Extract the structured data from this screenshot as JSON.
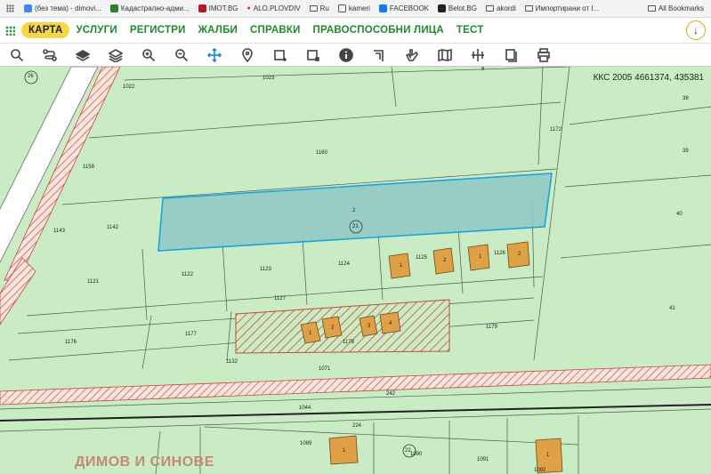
{
  "bookmarks": {
    "items": [
      {
        "label": "(без тема) - dimovi...",
        "icon": "google-icon"
      },
      {
        "label": "Кадастрално-адми...",
        "icon": "cadastre-icon"
      },
      {
        "label": "IMOT.BG",
        "icon": "imot-icon"
      },
      {
        "label": "ALO.PLOVDIV",
        "icon": "alo-icon"
      },
      {
        "label": "Ru",
        "icon": "folder-icon"
      },
      {
        "label": "kameri",
        "icon": "camera-icon"
      },
      {
        "label": "FACEBOOK",
        "icon": "facebook-icon"
      },
      {
        "label": "Belot.BG",
        "icon": "belot-icon"
      },
      {
        "label": "akordi",
        "icon": "folder-icon"
      },
      {
        "label": "Импортирани от I...",
        "icon": "folder-icon"
      }
    ],
    "all_label": "All Bookmarks"
  },
  "menu": {
    "items": [
      "КАРТА",
      "УСЛУГИ",
      "РЕГИСТРИ",
      "ЖАЛБИ",
      "СПРАВКИ",
      "ПРАВОСПОСОБНИ ЛИЦА",
      "ТЕСТ"
    ],
    "active": "КАРТА"
  },
  "toolbar": {
    "tools": [
      "search",
      "route",
      "layers",
      "stack",
      "zoom-in",
      "zoom-out",
      "pan",
      "location",
      "draw-rect",
      "edit-rect",
      "info",
      "corner",
      "hand",
      "book",
      "cross",
      "pages",
      "print"
    ],
    "active": "pan"
  },
  "map": {
    "coords": "ККС 2005 4661374, 435381",
    "company_label": "ДИМОВ И СИНОВЕ",
    "selected_parcel": {
      "id": "1160",
      "number": "2",
      "circle_label": "21"
    },
    "parcel_labels": [
      "1022",
      "1023",
      "1160",
      "1172",
      "1159",
      "38",
      "39",
      "40",
      "41",
      "1142",
      "1143",
      "1121",
      "1122",
      "1123",
      "1124",
      "1125",
      "1126",
      "1127",
      "1176",
      "1177",
      "1178",
      "1179",
      "1132",
      "1071",
      "242",
      "1044",
      "224",
      "1089",
      "1090",
      "1091",
      "1092",
      "22",
      "26",
      "2",
      "1",
      "3",
      "4",
      "8"
    ],
    "colors": {
      "background": "#c9ecc5",
      "selected_fill": "#8ec8c4",
      "selected_stroke": "#1aa3e0",
      "building": "#e0a046",
      "hatch": "#d24a3a"
    }
  }
}
